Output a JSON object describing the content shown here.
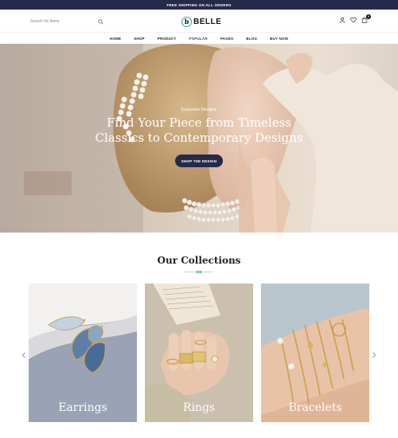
{
  "announcement": "FREE SHIPPING ON ALL ORDERS",
  "search": {
    "placeholder": "Search for items"
  },
  "logo": {
    "mark": "b",
    "text": "BELLE"
  },
  "header_icons": [
    "user-icon",
    "heart-icon",
    "bag-icon"
  ],
  "cart": {
    "count": "0"
  },
  "nav": [
    "HOME",
    "SHOP",
    "PRODUCT",
    "POPULAR",
    "PAGES",
    "BLOG",
    "BUY NOW"
  ],
  "hero": {
    "kicker": "Exclusive Designs",
    "title_line1": "Find Your Piece from Timeless",
    "title_line2": "Classics to Contemporary Designs",
    "button": "SHOP THE DESIGN"
  },
  "collections": {
    "title": "Our Collections",
    "items": [
      "Earrings",
      "Rings",
      "Bracelets"
    ]
  },
  "colors": {
    "dark": "#262a4a",
    "accent": "#2aa197"
  }
}
